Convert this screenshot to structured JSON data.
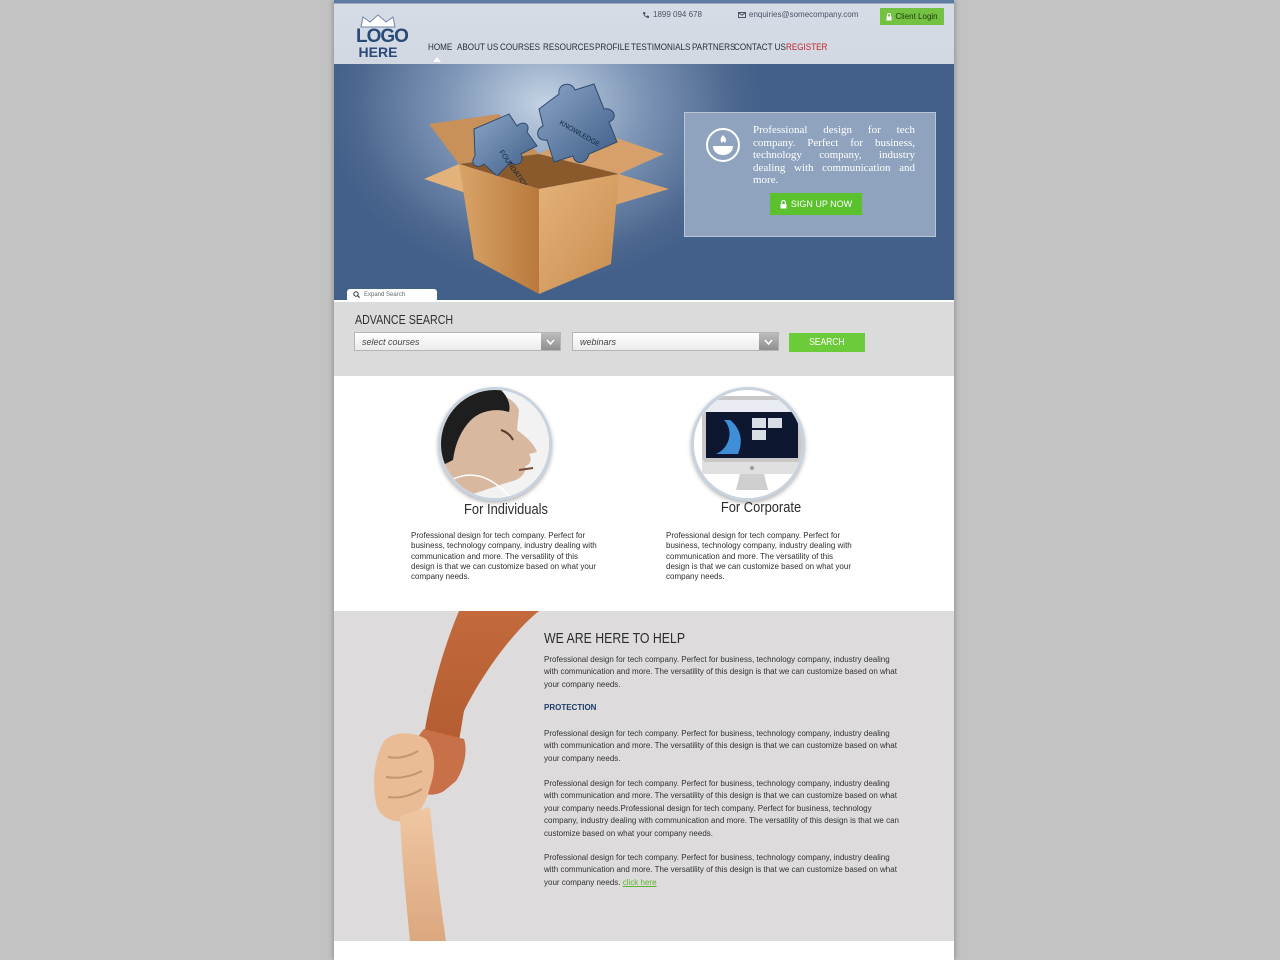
{
  "header": {
    "logo_line1": "LOGO",
    "logo_line2": "HERE",
    "phone": "1899 094 678",
    "email": "enquiries@somecompany.com",
    "client_login": "Client Login"
  },
  "nav": [
    {
      "label": "HOME"
    },
    {
      "label": "ABOUT US"
    },
    {
      "label": "COURSES"
    },
    {
      "label": "RESOURCES"
    },
    {
      "label": "PROFILE"
    },
    {
      "label": "TESTIMONIALS"
    },
    {
      "label": "PARTNERS"
    },
    {
      "label": "CONTACT US"
    },
    {
      "label": "REGISTER"
    }
  ],
  "hero": {
    "puzzle_word_1": "FOUNDATION",
    "puzzle_word_2": "KNOWLEDGE",
    "card_text": "Professional design for tech company. Perfect for business, technology company, industry dealing with communication and more.",
    "signup_label": "SIGN UP NOW",
    "expand_search": "Expand Search"
  },
  "advance_search": {
    "title": "ADVANCE SEARCH",
    "select_courses": "select courses",
    "select_webinars": "webinars",
    "search_label": "SEARCH"
  },
  "audience": [
    {
      "title": "For Individuals",
      "text": "Professional design for tech company. Perfect for business, technology company, industry dealing with communication and more. The versatility of this design is that we can customize based on what your company needs."
    },
    {
      "title": "For Corporate",
      "text": "Professional design for tech company. Perfect for business, technology company, industry dealing with communication and more. The versatility of this design is that we can customize based on what your company needs."
    }
  ],
  "help": {
    "title": "WE ARE HERE TO HELP",
    "p1": "Professional design for tech company. Perfect for business, technology company, industry dealing with communication and more. The versatility of this design is that we can customize based on what your company needs.",
    "subtitle": "PROTECTION",
    "p2": "Professional design for tech company. Perfect for business, technology company, industry dealing with communication and more. The versatility of this design is that we can customize based on what your company needs.",
    "p3": "Professional design for tech company. Perfect for business, technology company, industry dealing with communication and more. The versatility of this design is that we can customize based on what your company needs.Professional design for tech company. Perfect for business, technology company, industry dealing with communication and more. The versatility of this design is that we can customize based on what your company needs.",
    "p4": "Professional design for tech company. Perfect for business, technology company, industry dealing with communication and more. The versatility of this design is that we can customize based on what your company needs.",
    "link": "click here"
  },
  "colors": {
    "accent_green": "#6ccb38",
    "brand_blue": "#2a4a78",
    "register_red": "#c0262c"
  }
}
